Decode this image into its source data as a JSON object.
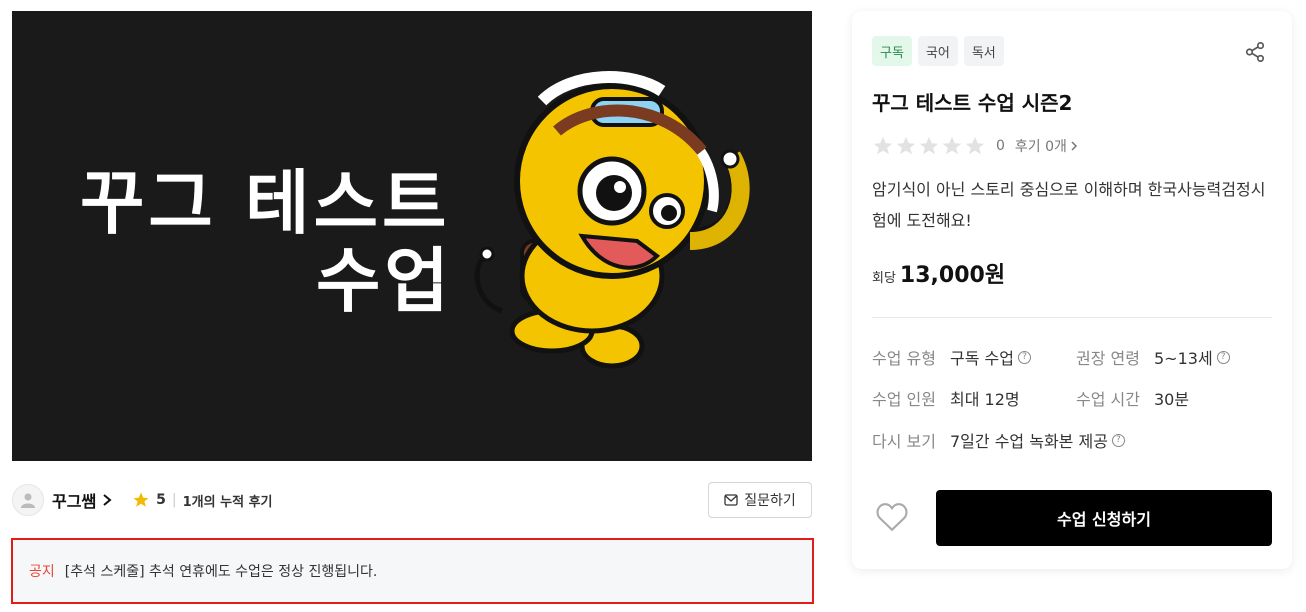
{
  "hero": {
    "title_line1": "꾸그 테스트",
    "title_line2": "수업"
  },
  "teacher": {
    "name": "꾸그쌤",
    "rating": "5",
    "review_summary": "1개의 누적 후기",
    "ask_label": "질문하기"
  },
  "notice": {
    "tag": "공지",
    "text": "[추석 스케줄] 추석 연휴에도 수업은 정상 진행됩니다."
  },
  "course": {
    "tags": [
      "구독",
      "국어",
      "독서"
    ],
    "title": "꾸그 테스트 수업 시즌2",
    "score": "0",
    "reviews_label": "후기 0개",
    "description": "암기식이 아닌 스토리 중심으로 이해하며 한국사능력검정시험에 도전해요!",
    "price_label": "회당",
    "price": "13,000원",
    "info": {
      "type_label": "수업 유형",
      "type_value": "구독 수업",
      "age_label": "권장 연령",
      "age_value": "5~13세",
      "size_label": "수업 인원",
      "size_value": "최대 12명",
      "duration_label": "수업 시간",
      "duration_value": "30분",
      "replay_label": "다시 보기",
      "replay_value": "7일간 수업 녹화본 제공"
    },
    "apply_label": "수업 신청하기"
  },
  "icons": {
    "share": "share-icon",
    "heart": "heart-icon",
    "star": "star-icon",
    "mail": "mail-icon",
    "help": "help-circle-icon",
    "chevron": "chevron-right-icon"
  },
  "colors": {
    "accent_red": "#e8443a",
    "notice_border": "#e31b1b",
    "tag_sub_bg": "#e3f7ea",
    "tag_sub_fg": "#2a8b4c",
    "star_yellow": "#f5b900",
    "hero_bg": "#1a1a1a",
    "button_black": "#000000"
  }
}
